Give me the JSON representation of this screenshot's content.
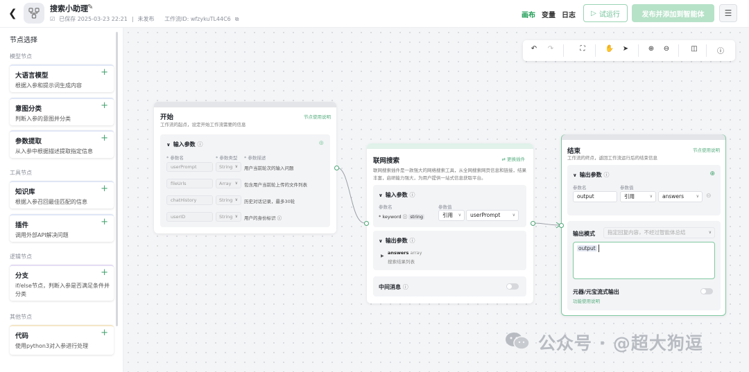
{
  "header": {
    "title": "搜索小助理",
    "saved_status": "已保存 2025-03-23 22:21",
    "publish_status": "未发布",
    "workflow_id": "工作流ID: wfzykuTL44C6",
    "nav": [
      "画布",
      "变量",
      "日志"
    ],
    "run_label": "试运行",
    "publish_label": "发布并添加到智能体"
  },
  "sidebar": {
    "title": "节点选择",
    "groups": [
      "模型节点",
      "工具节点",
      "逻辑节点",
      "其他节点"
    ],
    "items": [
      {
        "name": "大语言模型",
        "desc": "根据入参和提示词生成内容"
      },
      {
        "name": "意图分类",
        "desc": "判断入参的意图并分类"
      },
      {
        "name": "参数提取",
        "desc": "从入参中根据描述提取指定信息"
      },
      {
        "name": "知识库",
        "desc": "根据入参召回最佳匹配的信息"
      },
      {
        "name": "插件",
        "desc": "调用外部API解决问题"
      },
      {
        "name": "分支",
        "desc": "if/else节点，判断入参是否满足条件并分类"
      },
      {
        "name": "代码",
        "desc": "使用python3对入参进行处理"
      }
    ]
  },
  "start_node": {
    "title": "开始",
    "desc": "工作流的起点，设定开始工作流需要的信息",
    "link": "节点使用说明",
    "section": "输入参数",
    "cols": [
      "参数名",
      "参数类型",
      "参数描述"
    ],
    "rows": [
      {
        "name": "userPrompt",
        "type": "String",
        "desc": "用户当前轮次的输入问题"
      },
      {
        "name": "fileUrls",
        "type": "Array",
        "desc": "包含用户当前轮上传的文件列表"
      },
      {
        "name": "chatHistory",
        "type": "String",
        "desc": "历史对话记录，最多30轮"
      },
      {
        "name": "userID",
        "type": "String",
        "desc": "用户的身份标识"
      }
    ]
  },
  "search_node": {
    "title": "联网搜索",
    "link": "更换插件",
    "desc1": "联网搜索插件是一款强大的网络搜索工具，从全网搜索网页信息和链接，结果",
    "desc2": "丰富，启研能力强大，为用户提供一站式信息获取平台。",
    "input_section": "输入参数",
    "col_name": "参数名",
    "col_value": "参数值",
    "param_name": "keyword",
    "param_type": "string",
    "ref_label": "引用",
    "ref_value": "userPrompt",
    "output_section": "输出参数",
    "out_name": "answers",
    "out_type": "array",
    "out_desc": "搜索结果列表",
    "middle_msg": "中间消息"
  },
  "end_node": {
    "title": "结束",
    "link": "节点使用说明",
    "desc": "工作流的终点，返回工作流运行后的结束信息",
    "section": "输出参数",
    "col_name": "参数名",
    "col_value": "参数值",
    "out_name": "output",
    "ref_label": "引用",
    "ref_value": "answers",
    "mode_label": "输出模式",
    "mode_value": "指定回复内容，不经过智能体总结",
    "editor_tag": "output",
    "stream_label": "元器/元宝流式输出",
    "stream_link": "功能使用说明"
  },
  "watermark": "公众号 · @超大狗逗"
}
